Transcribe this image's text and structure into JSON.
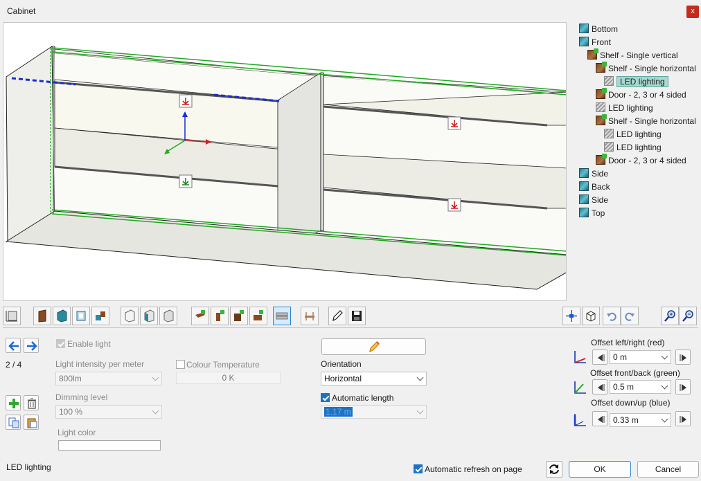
{
  "window": {
    "title": "Cabinet",
    "close_label": "x"
  },
  "tree": {
    "items": [
      {
        "label": "Bottom",
        "icon": "cube",
        "indent": 0
      },
      {
        "label": "Front",
        "icon": "cube",
        "indent": 0
      },
      {
        "label": "Shelf - Single vertical",
        "icon": "shelf",
        "indent": 1
      },
      {
        "label": "Shelf - Single horizontal",
        "icon": "shelf",
        "indent": 2
      },
      {
        "label": "LED lighting",
        "icon": "led",
        "indent": 3,
        "selected": true
      },
      {
        "label": "Door - 2, 3 or 4 sided",
        "icon": "shelf",
        "indent": 2
      },
      {
        "label": "LED lighting",
        "icon": "led",
        "indent": 2
      },
      {
        "label": "Shelf - Single horizontal",
        "icon": "shelf",
        "indent": 2
      },
      {
        "label": "LED lighting",
        "icon": "led",
        "indent": 3
      },
      {
        "label": "LED lighting",
        "icon": "led",
        "indent": 3
      },
      {
        "label": "Door - 2, 3 or 4 sided",
        "icon": "shelf",
        "indent": 2
      },
      {
        "label": "Side",
        "icon": "cube",
        "indent": 0
      },
      {
        "label": "Back",
        "icon": "cube",
        "indent": 0
      },
      {
        "label": "Side",
        "icon": "cube",
        "indent": 0
      },
      {
        "label": "Top",
        "icon": "cube",
        "indent": 0
      }
    ]
  },
  "nav": {
    "counter": "2 / 4"
  },
  "light": {
    "enable_label": "Enable light",
    "intensity_label": "Light intensity per meter",
    "intensity_value": "800lm",
    "dimming_label": "Dimming level",
    "dimming_value": "100 %",
    "color_label": "Light color",
    "colour_temp_label": "Colour Temperature",
    "colour_temp_value": "0 K"
  },
  "orientation": {
    "label": "Orientation",
    "value": "Horizontal",
    "auto_length_label": "Automatic length",
    "length_value": "1.17 m"
  },
  "offsets": {
    "left_right_label": "Offset left/right (red)",
    "left_right_value": "0 m",
    "front_back_label": "Offset front/back (green)",
    "front_back_value": "0.5 m",
    "down_up_label": "Offset down/up (blue)",
    "down_up_value": "0.33 m"
  },
  "footer": {
    "status": "LED lighting",
    "auto_refresh_label": "Automatic refresh on page",
    "ok_label": "OK",
    "cancel_label": "Cancel"
  },
  "colors": {
    "accent": "#1a73c8",
    "selection": "#a8d8d0",
    "close": "#c42b1c"
  }
}
